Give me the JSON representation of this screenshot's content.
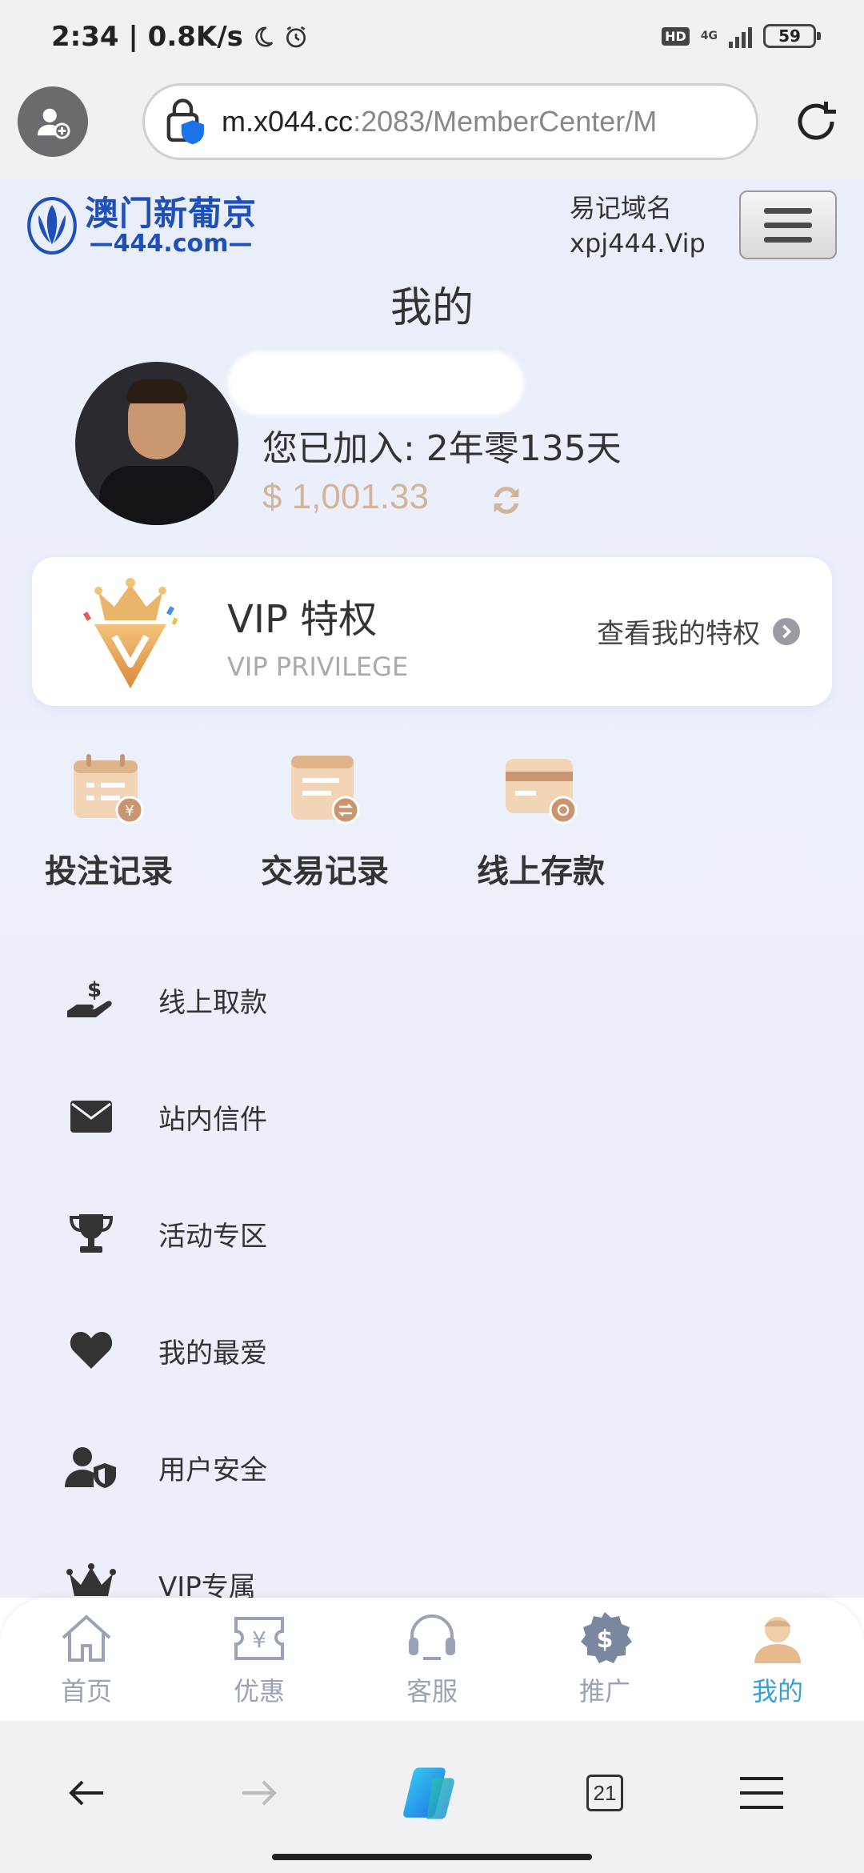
{
  "status_bar": {
    "time": "2:34 | 0.8K/s",
    "hd": "HD",
    "network": "4G",
    "battery": "59"
  },
  "browser": {
    "url_main": "m.x044.cc",
    "url_rest": ":2083/MemberCenter/M"
  },
  "header": {
    "logo_cn": "澳门新葡京",
    "logo_en": "444.com",
    "domain_label": "易记域名",
    "domain_value": "xpj444.Vip"
  },
  "page_title": "我的",
  "profile": {
    "joined": "您已加入: 2年零135天",
    "balance": "$ 1,001.33"
  },
  "vip": {
    "title": "VIP 特权",
    "subtitle": "VIP PRIVILEGE",
    "link": "查看我的特权"
  },
  "quick_actions": [
    {
      "label": "投注记录",
      "icon": "betting-record-icon"
    },
    {
      "label": "交易记录",
      "icon": "transaction-record-icon"
    },
    {
      "label": "线上存款",
      "icon": "online-deposit-icon"
    }
  ],
  "menu": [
    {
      "label": "线上取款",
      "icon": "hand-dollar-icon"
    },
    {
      "label": "站内信件",
      "icon": "envelope-icon"
    },
    {
      "label": "活动专区",
      "icon": "trophy-icon"
    },
    {
      "label": "我的最爱",
      "icon": "heart-icon"
    },
    {
      "label": "用户安全",
      "icon": "user-shield-icon"
    },
    {
      "label": "VIP专属",
      "icon": "crown-icon"
    }
  ],
  "tabbar": [
    {
      "label": "首页",
      "icon": "home-icon"
    },
    {
      "label": "优惠",
      "icon": "coupon-icon"
    },
    {
      "label": "客服",
      "icon": "headset-icon"
    },
    {
      "label": "推广",
      "icon": "promote-icon"
    },
    {
      "label": "我的",
      "icon": "user-icon",
      "active": true
    }
  ],
  "browser_nav": {
    "tab_count": "21"
  },
  "colors": {
    "accent": "#3ca0d8",
    "balance": "#d2b598",
    "page_bg": "#eceef9",
    "logo_blue": "#1f4fb8"
  }
}
